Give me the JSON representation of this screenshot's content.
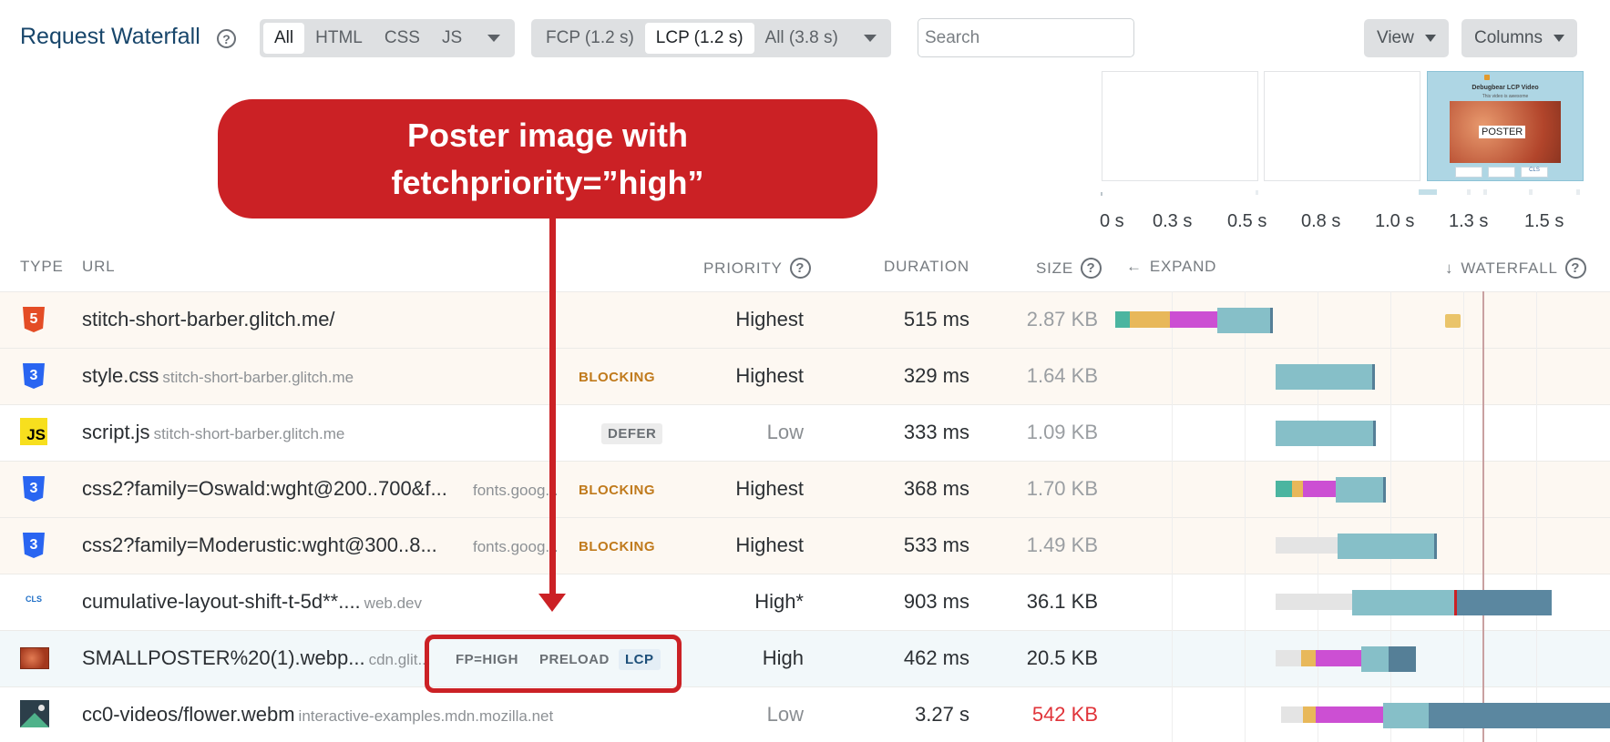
{
  "header": {
    "title": "Request Waterfall",
    "help_glyph": "?",
    "type_filters": [
      "All",
      "HTML",
      "CSS",
      "JS"
    ],
    "milestones": [
      "FCP (1.2 s)",
      "LCP (1.2 s)",
      "All (3.8 s)"
    ],
    "search_placeholder": "Search",
    "view_label": "View",
    "columns_label": "Columns"
  },
  "filmstrip": {
    "frame3": {
      "title": "Debugbear LCP Video",
      "subtitle": "This video is awesome",
      "poster_label": "POSTER",
      "mini_badges": [
        "",
        "",
        "CLS"
      ]
    },
    "time_labels": [
      "0 s",
      "0.3 s",
      "0.5 s",
      "0.8 s",
      "1.0 s",
      "1.3 s",
      "1.5 s"
    ]
  },
  "callout": {
    "line1": "Poster image with",
    "line2": "fetchpriority=”high”"
  },
  "table": {
    "headers": {
      "type": "TYPE",
      "url": "URL",
      "priority": "PRIORITY",
      "duration": "DURATION",
      "size": "SIZE",
      "expand": "EXPAND",
      "expand_icon": "←",
      "waterfall": "WATERFALL",
      "waterfall_icon": "↓"
    },
    "rows": [
      {
        "type": "html",
        "icon_text": "5",
        "url": "stitch-short-barber.glitch.me/",
        "domain": "",
        "tags": [],
        "priority": "Highest",
        "duration": "515 ms",
        "size": "2.87 KB"
      },
      {
        "type": "css",
        "icon_text": "3",
        "url": "style.css",
        "domain": "stitch-short-barber.glitch.me",
        "tags": [
          "BLOCKING"
        ],
        "priority": "Highest",
        "duration": "329 ms",
        "size": "1.64 KB"
      },
      {
        "type": "js",
        "icon_text": "JS",
        "url": "script.js",
        "domain": "stitch-short-barber.glitch.me",
        "tags": [
          "DEFER"
        ],
        "priority": "Low",
        "duration": "333 ms",
        "size": "1.09 KB"
      },
      {
        "type": "css",
        "icon_text": "3",
        "url": "css2?family=Oswald:wght@200..700&f...",
        "domain": "fonts.goog...",
        "tags": [
          "BLOCKING"
        ],
        "priority": "Highest",
        "duration": "368 ms",
        "size": "1.70 KB"
      },
      {
        "type": "css",
        "icon_text": "3",
        "url": "css2?family=Moderustic:wght@300..8...",
        "domain": "fonts.goog...",
        "tags": [
          "BLOCKING"
        ],
        "priority": "Highest",
        "duration": "533 ms",
        "size": "1.49 KB"
      },
      {
        "type": "image-cls",
        "icon_text": "CLS",
        "url": "cumulative-layout-shift-t-5d**....",
        "domain": "web.dev",
        "tags": [],
        "priority": "High*",
        "duration": "903 ms",
        "size": "36.1 KB"
      },
      {
        "type": "image-poster",
        "icon_text": "",
        "url": "SMALLPOSTER%20(1).webp...",
        "domain": "cdn.glit...",
        "tags": [
          "FP=HIGH",
          "PRELOAD",
          "LCP"
        ],
        "priority": "High",
        "duration": "462 ms",
        "size": "20.5 KB"
      },
      {
        "type": "video",
        "icon_text": "",
        "url": "cc0-videos/flower.webm",
        "domain": "interactive-examples.mdn.mozilla.net",
        "tags": [],
        "priority": "Low",
        "duration": "3.27 s",
        "size": "542 KB"
      }
    ]
  },
  "colors": {
    "accent_title": "#18466b",
    "callout_red": "#cb2125",
    "blocking": "#c07a1c",
    "size_warning": "#e0343a",
    "bar_waiting": "#e4e4e4",
    "bar_dns": "#4bb5a0",
    "bar_connect": "#e8b85a",
    "bar_ssl": "#cc4fd3",
    "bar_download": "#86bfc8",
    "bar_receive": "#557f97"
  }
}
